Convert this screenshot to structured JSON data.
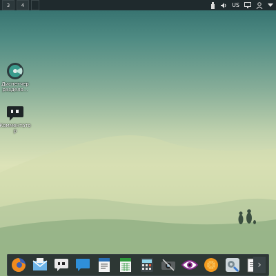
{
  "topbar": {
    "workspaces": [
      "3",
      "4",
      ""
    ],
    "tray": {
      "keyboard_layout": "US",
      "icons": [
        "usb-drive-icon",
        "volume-icon",
        "network-monitor-icon",
        "user-icon",
        "menu-arrow-icon"
      ]
    }
  },
  "desktop": {
    "icons": [
      {
        "name": "partition-manager",
        "label_line1": "Диспетчер",
        "label_line2": "раздело..."
      },
      {
        "name": "chat-app",
        "label_line1": "Комментато",
        "label_line2": "р"
      }
    ]
  },
  "dock": {
    "items": [
      "firefox-icon",
      "mail-icon",
      "chat-icon",
      "messenger-icon",
      "writer-icon",
      "calc-icon",
      "calculator-icon",
      "screenshot-icon",
      "eye-viewer-icon",
      "orange-app-icon",
      "settings-icon",
      "editor-icon"
    ],
    "more_arrow": "›"
  },
  "colors": {
    "panel": "#1f2a2d",
    "sky_top": "#2f6b6a",
    "horizon": "#dde3b8"
  }
}
